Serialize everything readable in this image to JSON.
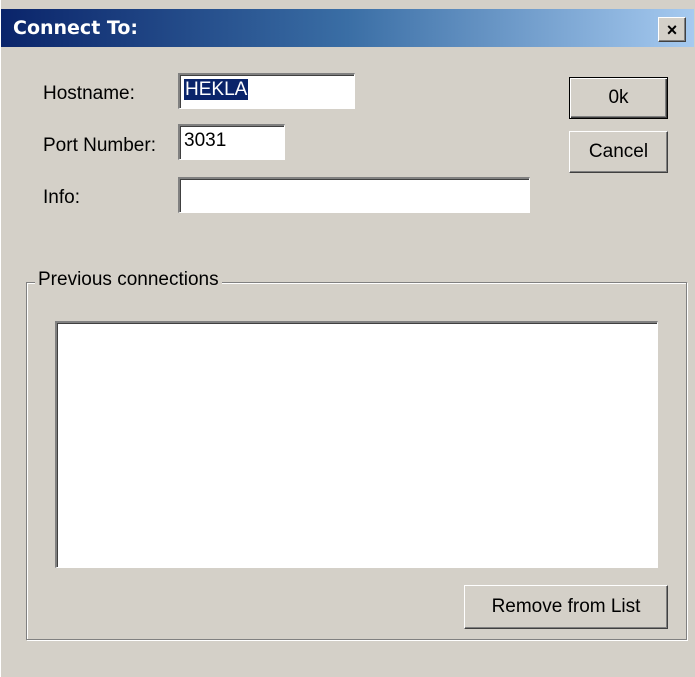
{
  "window": {
    "title": "Connect To:",
    "close_symbol": "×"
  },
  "form": {
    "hostname_label": "Hostname:",
    "hostname_value": "HEKLA",
    "port_label": "Port Number:",
    "port_value": "3031",
    "info_label": "Info:",
    "info_value": ""
  },
  "buttons": {
    "ok_label": "0k",
    "cancel_label": "Cancel",
    "remove_label": "Remove from List"
  },
  "previous_connections": {
    "legend": "Previous connections",
    "items": []
  },
  "icons": {
    "close": "close-icon"
  },
  "colors": {
    "title_gradient_start": "#0a246a",
    "title_gradient_end": "#a6caf0",
    "dialog_bg": "#d4d0c8",
    "selection_bg": "#0a246a"
  }
}
